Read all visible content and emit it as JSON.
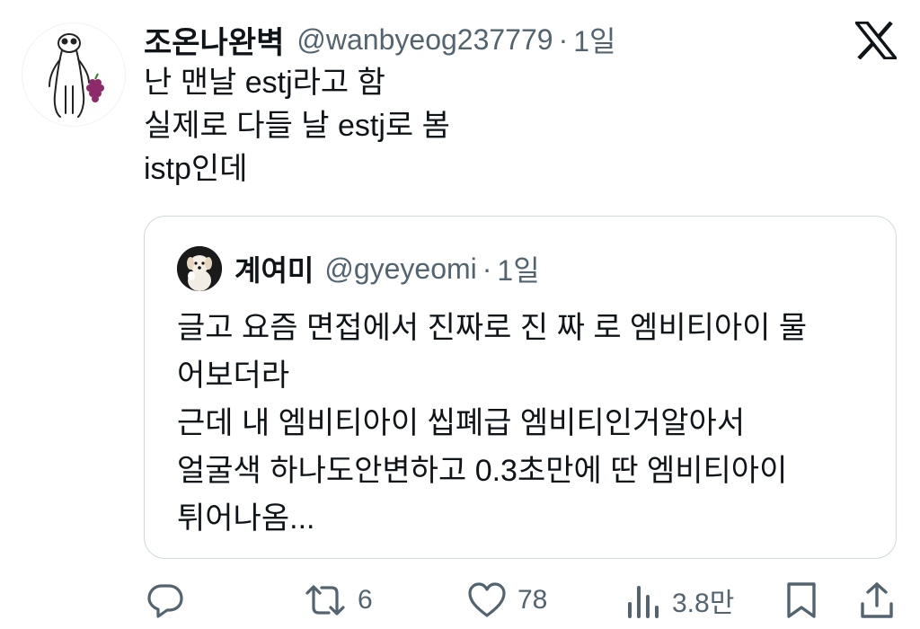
{
  "tweet": {
    "display_name": "조온나완벽",
    "handle": "@wanbyeog237779",
    "separator": "·",
    "time": "1일",
    "text": "난 맨날 estj라고 함\n실제로 다들 날 estj로 봄\nistp인데"
  },
  "quote": {
    "display_name": "계여미",
    "handle": "@gyeyeomi",
    "separator": "·",
    "time": "1일",
    "text": "글고 요즘 면접에서 진짜로 진 짜 로 엠비티아이 물\n어보더라\n근데 내 엠비티아이 씹폐급 엠비티인거알아서\n얼굴색 하나도안변하고 0.3초만에 딴 엠비티아이\n튀어나옴..."
  },
  "actions": {
    "reply_count": "",
    "retweet_count": "6",
    "like_count": "78",
    "views_count": "3.8만"
  },
  "icons": {
    "logo": "x-logo-icon",
    "reply": "reply-icon",
    "retweet": "retweet-icon",
    "like": "heart-icon",
    "views": "views-icon",
    "bookmark": "bookmark-icon",
    "share": "share-icon"
  },
  "colors": {
    "text_primary": "#0f1419",
    "text_secondary": "#536471",
    "border": "#cfd9de",
    "grape": "#8e2a6b"
  }
}
